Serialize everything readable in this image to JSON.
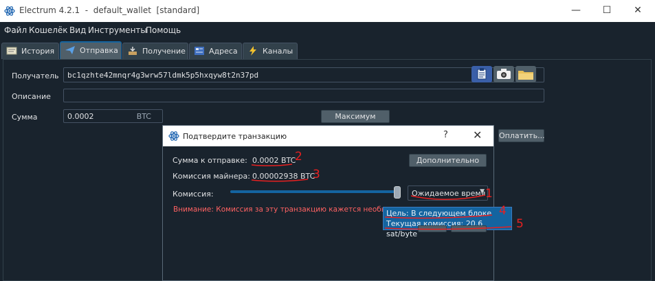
{
  "window": {
    "title": "Electrum 4.2.1  -  default_wallet  [standard]",
    "minimize": "—",
    "maximize": "☐",
    "close": "✕"
  },
  "menu": [
    "Файл",
    "Кошелёк",
    "Вид",
    "Инструменты",
    "Помощь"
  ],
  "tabs": [
    {
      "label": "История",
      "icon": "history-icon"
    },
    {
      "label": "Отправка",
      "icon": "send-icon"
    },
    {
      "label": "Получение",
      "icon": "receive-icon"
    },
    {
      "label": "Адреса",
      "icon": "addresses-icon"
    },
    {
      "label": "Каналы",
      "icon": "lightning-icon"
    }
  ],
  "send_form": {
    "recipient_label": "Получатель",
    "recipient_value": "bc1qzhte42mnqr4g3wrw57ldmk5p5hxqyw8t2n37pd",
    "description_label": "Описание",
    "description_value": "",
    "amount_label": "Сумма",
    "amount_value": "0.0002",
    "amount_unit": "BTC",
    "max_button": "Максимум",
    "pay_button": "Оплатить...",
    "tool_icons": [
      "paste-icon",
      "camera-icon",
      "folder-icon"
    ]
  },
  "dialog": {
    "title": "Подтвердите транзакцию",
    "help": "?",
    "close": "✕",
    "amount_label": "Сумма к отправке:",
    "amount_value": "0.0002 BTC",
    "miner_fee_label": "Комиссия майнера:",
    "miner_fee_value": "0.00002938 BTC",
    "advanced_button": "Дополнительно",
    "fee_label": "Комиссия:",
    "fee_mode": "Ожидаемое время",
    "fee_slider_level": 1.0,
    "warning": "Внимание: Комиссия за эту транзакцию кажется необычно высокой",
    "tooltip_line1": "Цель: В следующем блоке",
    "tooltip_line2": "Текущая комиссия: 20.6 sat/byte"
  },
  "annotations": [
    "1",
    "2",
    "3",
    "4",
    "5"
  ],
  "colors": {
    "background": "#19232d",
    "accent": "#1464a0",
    "warning": "#ff6262",
    "annotation": "#e82020"
  }
}
